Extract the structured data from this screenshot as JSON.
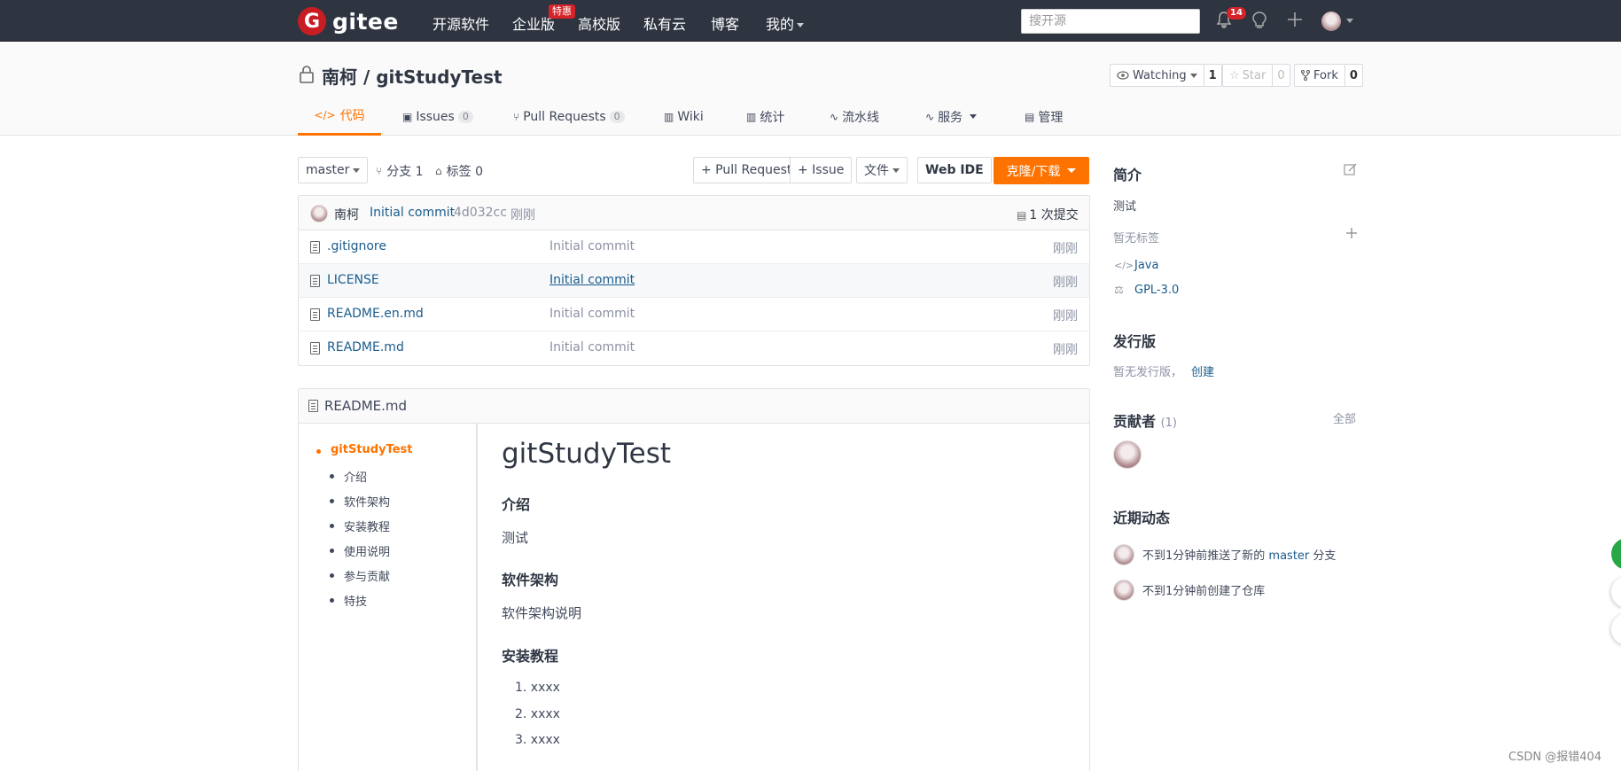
{
  "topnav": {
    "logo_mark": "G",
    "logo_text": "gitee",
    "items": [
      "开源软件",
      "企业版",
      "高校版",
      "私有云",
      "博客",
      "我的"
    ],
    "hot_badge": "特惠",
    "search_placeholder": "搜开源",
    "notif_count": "14",
    "icons": [
      "bell-icon",
      "bulb-icon",
      "plus-icon",
      "avatar"
    ]
  },
  "repo": {
    "owner_and_name": "南柯 / gitStudyTest",
    "watch": {
      "label": "Watching",
      "count": "1"
    },
    "star": {
      "label": "Star",
      "count": "0"
    },
    "fork": {
      "label": "Fork",
      "count": "0"
    }
  },
  "tabs": [
    {
      "label": "代码",
      "count": null,
      "icon": "code-icon"
    },
    {
      "label": "Issues",
      "count": "0",
      "icon": "issues-icon"
    },
    {
      "label": "Pull Requests",
      "count": "0",
      "icon": "pr-icon"
    },
    {
      "label": "Wiki",
      "count": null,
      "icon": "wiki-icon"
    },
    {
      "label": "统计",
      "count": null,
      "icon": "stats-icon"
    },
    {
      "label": "流水线",
      "count": null,
      "icon": "pipeline-icon"
    },
    {
      "label": "服务",
      "count": null,
      "icon": "service-icon"
    },
    {
      "label": "管理",
      "count": null,
      "icon": "manage-icon"
    }
  ],
  "toolbar": {
    "branch": "master",
    "branches": "分支 1",
    "tags": "标签 0",
    "pull_request": "+ Pull Request",
    "issue": "+ Issue",
    "file": "文件",
    "web_ide": "Web IDE",
    "clone": "克隆/下载"
  },
  "commit": {
    "author": "南柯",
    "message": "Initial commit",
    "hash": "4d032cc",
    "time": "刚刚",
    "count_label": "1 次提交"
  },
  "files": [
    {
      "name": ".gitignore",
      "message": "Initial commit",
      "time": "刚刚"
    },
    {
      "name": "LICENSE",
      "message": "Initial commit",
      "time": "刚刚"
    },
    {
      "name": "README.en.md",
      "message": "Initial commit",
      "time": "刚刚"
    },
    {
      "name": "README.md",
      "message": "Initial commit",
      "time": "刚刚"
    }
  ],
  "readme": {
    "filename": "README.md",
    "toc": [
      "gitStudyTest",
      "介绍",
      "软件架构",
      "安装教程",
      "使用说明",
      "参与贡献",
      "特技"
    ],
    "h1": "gitStudyTest",
    "sections": [
      {
        "heading": "介绍",
        "body": "测试"
      },
      {
        "heading": "软件架构",
        "body": "软件架构说明"
      },
      {
        "heading": "安装教程",
        "body": ""
      }
    ],
    "install_steps": [
      "1. xxxx",
      "2. xxxx",
      "3. xxxx"
    ]
  },
  "sidebar": {
    "intro_title": "简介",
    "intro_text": "测试",
    "no_tags": "暂无标签",
    "language": "Java",
    "license": "GPL-3.0",
    "release_title": "发行版",
    "release_text": "暂无发行版，",
    "release_create": "创建",
    "contrib_title": "贡献者",
    "contrib_count": "(1)",
    "contrib_all": "全部",
    "activity_title": "近期动态",
    "activity_1_prefix": "不到1分钟前推送了新的",
    "activity_1_branch": "master",
    "activity_1_suffix": "分支",
    "activity_2": "不到1分钟前创建了仓库"
  },
  "watermark": "CSDN @报错404",
  "colors": {
    "accent": "#fe7300",
    "nav_bg": "#2e3440",
    "link": "#1a5c8c",
    "brand_red": "#c71d23"
  }
}
